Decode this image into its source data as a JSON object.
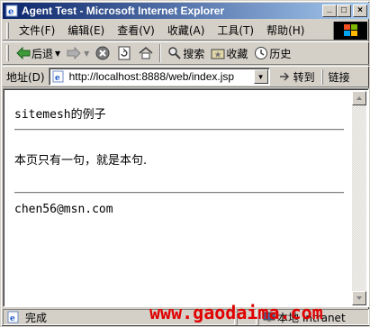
{
  "window": {
    "title": "Agent Test - Microsoft Internet Explorer",
    "controls": {
      "minimize": "_",
      "maximize": "□",
      "close": "×"
    }
  },
  "menubar": {
    "items": [
      {
        "label": "文件(F)"
      },
      {
        "label": "编辑(E)"
      },
      {
        "label": "查看(V)"
      },
      {
        "label": "收藏(A)"
      },
      {
        "label": "工具(T)"
      },
      {
        "label": "帮助(H)"
      }
    ]
  },
  "toolbar": {
    "back_label": "后退",
    "search_label": "搜索",
    "favorites_label": "收藏",
    "history_label": "历史"
  },
  "addressbar": {
    "label": "地址(D)",
    "url": "http://localhost:8888/web/index.jsp",
    "go_label": "转到",
    "links_label": "链接"
  },
  "page": {
    "title": "sitemesh的例子",
    "body": "本页只有一句，就是本句.",
    "footer": "chen56@msn.com"
  },
  "statusbar": {
    "status": "完成",
    "zone": "本地 Intranet"
  },
  "watermark": "www.gaodaima.com",
  "colors": {
    "titlebar_start": "#0a246a",
    "titlebar_end": "#a6caf0",
    "chrome": "#d4d0c8",
    "watermark": "#e00000"
  }
}
